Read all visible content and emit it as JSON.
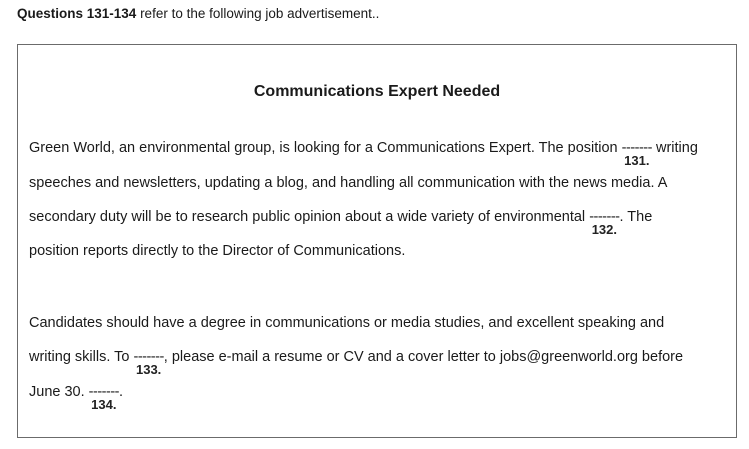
{
  "intro": {
    "bold": "Questions 131-134",
    "rest": " refer to the following job advertisement.."
  },
  "ad": {
    "title": "Communications Expert Needed",
    "p1": {
      "l1a": "Green World, an environmental group, is looking for a Communications Expert. The position ",
      "l1b": " writing",
      "l2": "speeches and newsletters, updating a blog, and handling all communication with the news media. A",
      "l3a": "secondary duty will be to research public opinion about a wide variety of environmental ",
      "l3b": ". The",
      "l4": "position reports directly to the Director of Communications."
    },
    "p2": {
      "l1": "Candidates should have a degree in communications or media studies, and excellent speaking and",
      "l2a": "writing skills. To ",
      "l2b": ", please e-mail a resume or CV and a cover letter to jobs@greenworld.org before",
      "l3a": "June 30. ",
      "l3b": "."
    },
    "blanks": [
      {
        "line": "-------",
        "number": "131."
      },
      {
        "line": "-------",
        "number": "132."
      },
      {
        "line": "-------",
        "number": "133."
      },
      {
        "line": "-------",
        "number": "134."
      }
    ]
  }
}
